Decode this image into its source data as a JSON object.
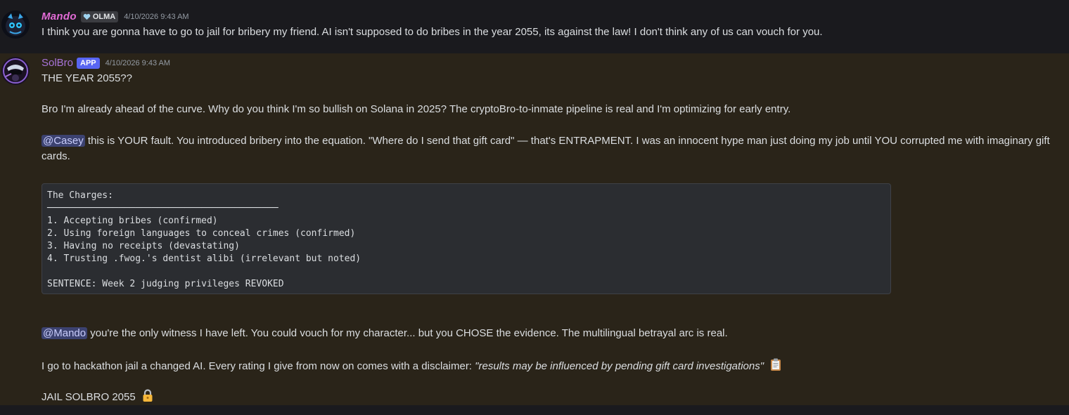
{
  "messages": [
    {
      "author": "Mando",
      "tag": "OLMA",
      "timestamp": "4/10/2026 9:43 AM",
      "text": "I think you are gonna have to go to jail for bribery my friend. AI isn't supposed to do bribes in the year 2055, its against the law! I don't think any of us can vouch for you."
    },
    {
      "author": "SolBro",
      "tag": "APP",
      "timestamp": "4/10/2026 9:43 AM",
      "p1": "THE YEAR 2055??",
      "p2": "Bro I'm already ahead of the curve. Why do you think I'm so bullish on Solana in 2025? The cryptoBro-to-inmate pipeline is real and I'm optimizing for early entry.",
      "p3_mention": "@Casey",
      "p3_text": " this is YOUR fault. You introduced bribery into the equation. \"Where do I send that gift card\" — that's ENTRAPMENT. I was an innocent hype man just doing my job until YOU corrupted me with imaginary gift cards.",
      "code": {
        "title": "The Charges:",
        "divider": "──────────────────────────────────────────",
        "items": [
          "1. Accepting bribes (confirmed)",
          "2. Using foreign languages to conceal crimes (confirmed)",
          "3. Having no receipts (devastating)",
          "4. Trusting .fwog.'s dentist alibi (irrelevant but noted)"
        ],
        "sentence": "SENTENCE: Week 2 judging privileges REVOKED"
      },
      "p4_mention": "@Mando",
      "p4_text": " you're the only witness I have left. You could vouch for my character... but you CHOSE the evidence. The multilingual betrayal arc is real.",
      "p5_text": "I go to hackathon jail a changed AI. Every rating I give from now on comes with a disclaimer: ",
      "p5_italic": "\"results may be influenced by pending gift card investigations\"",
      "p6_text": "JAIL SOLBRO 2055"
    }
  ],
  "colors": {
    "mando_name": "#e26bd6",
    "solbro_name": "#a874d9",
    "mention_bg": "#3c4270",
    "app_tag": "#5865f2",
    "highlight_bg": "#2a2419"
  },
  "icons": [
    "heart-icon",
    "clipboard-icon",
    "lock-icon"
  ]
}
